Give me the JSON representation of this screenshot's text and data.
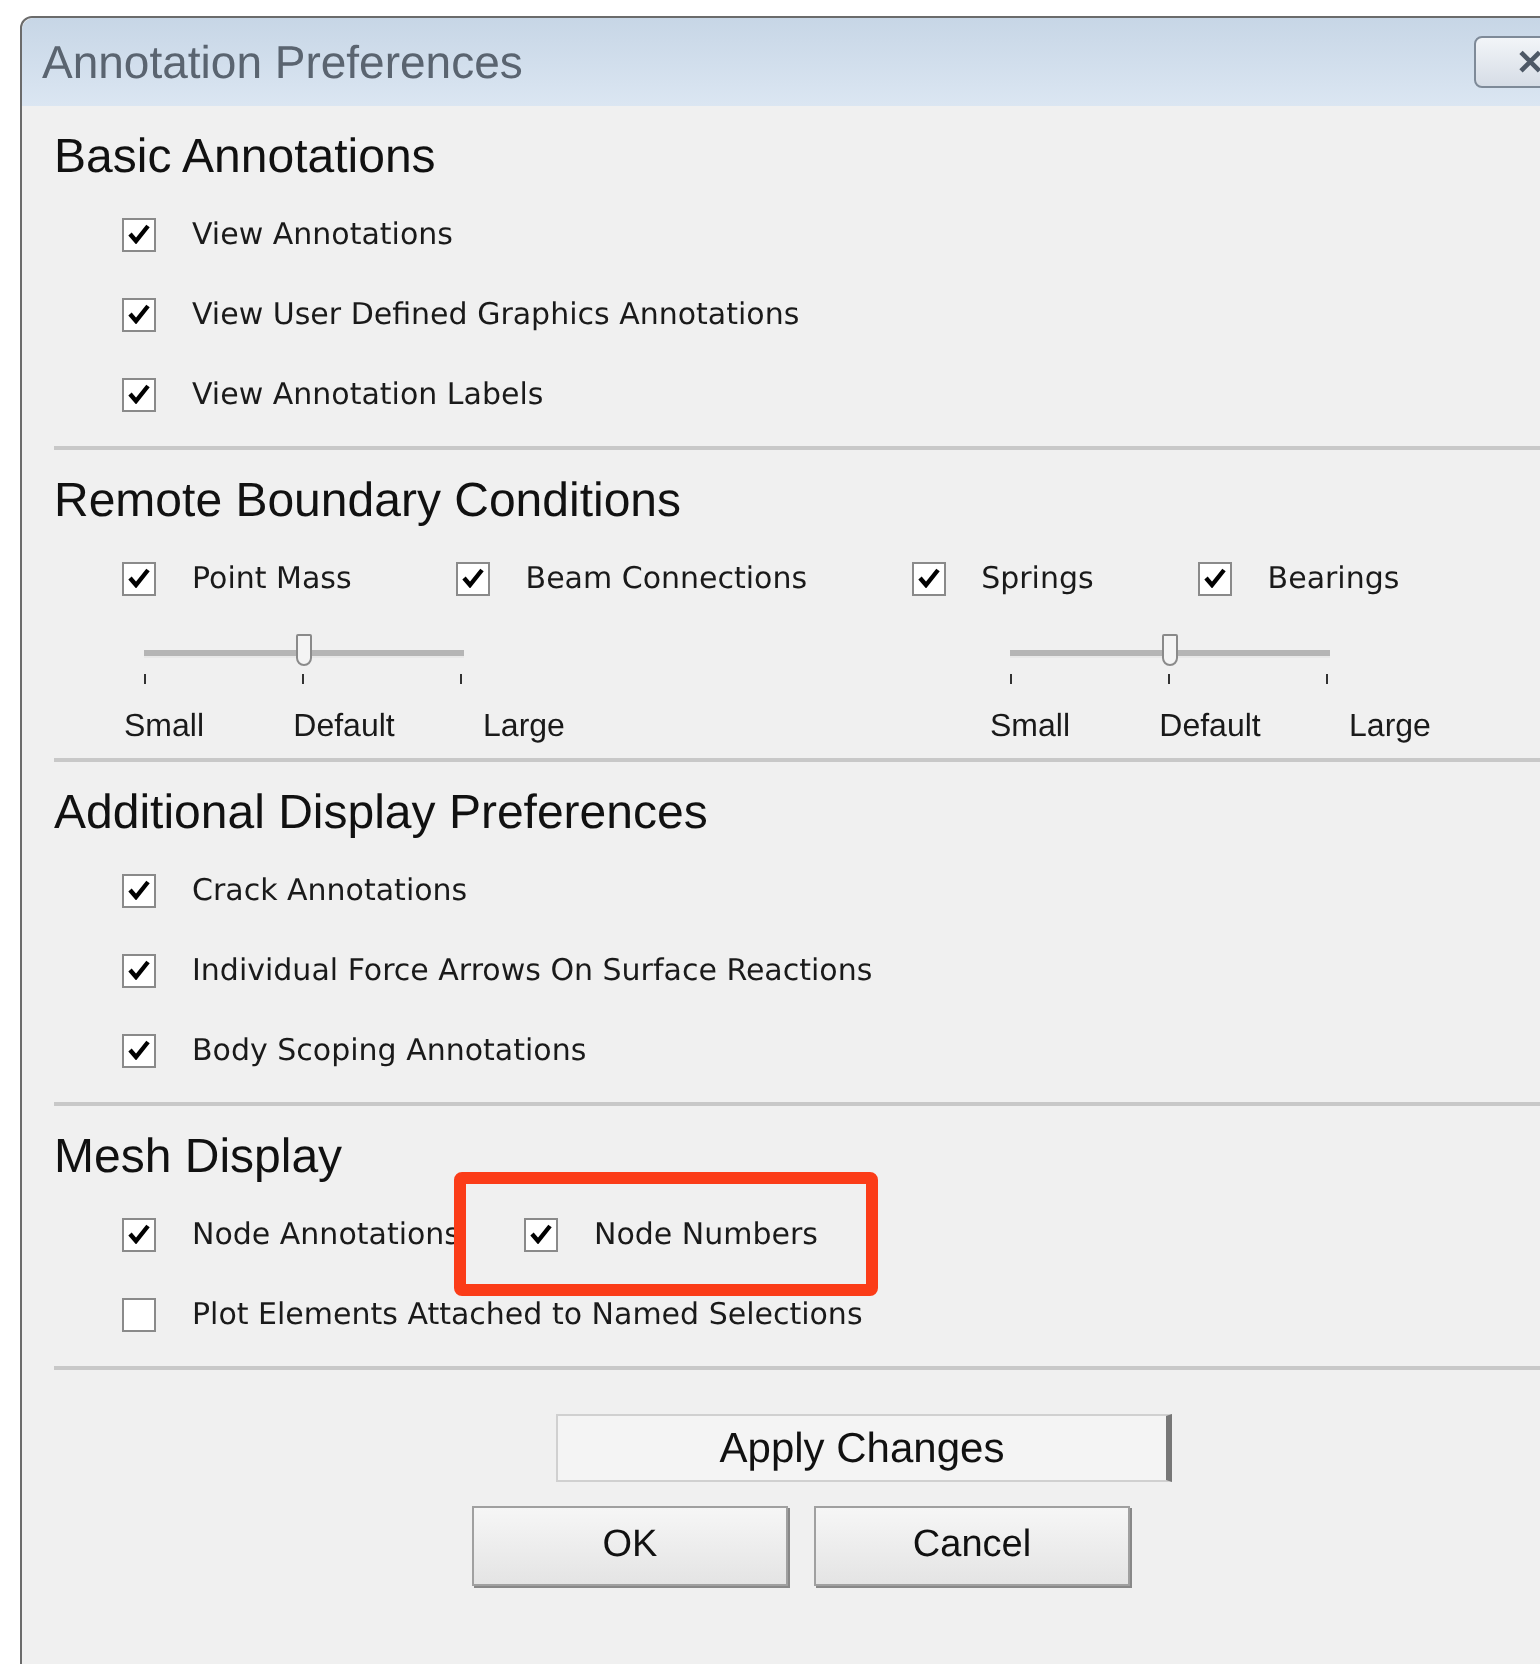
{
  "window": {
    "title": "Annotation Preferences",
    "close": "✕"
  },
  "sections": [
    {
      "title": "Basic Annotations",
      "rows": [
        [
          {
            "label": "View Annotations",
            "checked": true
          }
        ],
        [
          {
            "label": "View User Defined Graphics Annotations",
            "checked": true
          }
        ],
        [
          {
            "label": "View Annotation Labels",
            "checked": true
          }
        ]
      ]
    },
    {
      "title": "Remote Boundary Conditions",
      "rows": [
        [
          {
            "label": "Point Mass",
            "checked": true
          },
          {
            "label": "Beam Connections",
            "checked": true
          },
          {
            "label": "Springs",
            "checked": true
          },
          {
            "label": "Bearings",
            "checked": true
          }
        ]
      ],
      "sliders": [
        {
          "level": 0.5,
          "labels": [
            "Small",
            "Default",
            "Large"
          ]
        },
        {
          "level": 0.5,
          "labels": [
            "Small",
            "Default",
            "Large"
          ]
        }
      ]
    },
    {
      "title": "Additional Display Preferences",
      "rows": [
        [
          {
            "label": "Crack Annotations",
            "checked": true
          }
        ],
        [
          {
            "label": "Individual Force Arrows On Surface Reactions",
            "checked": true
          }
        ],
        [
          {
            "label": "Body Scoping Annotations",
            "checked": true
          }
        ]
      ]
    },
    {
      "title": "Mesh Display",
      "rows": [
        [
          {
            "label": "Node Annotations",
            "checked": true
          },
          {
            "label": "Node Numbers",
            "checked": true,
            "highlighted": true
          }
        ],
        [
          {
            "label": "Plot Elements Attached to Named Selections",
            "checked": false
          }
        ]
      ]
    }
  ],
  "apply_button": "Apply Changes",
  "buttons": [
    "OK",
    "Cancel"
  ]
}
